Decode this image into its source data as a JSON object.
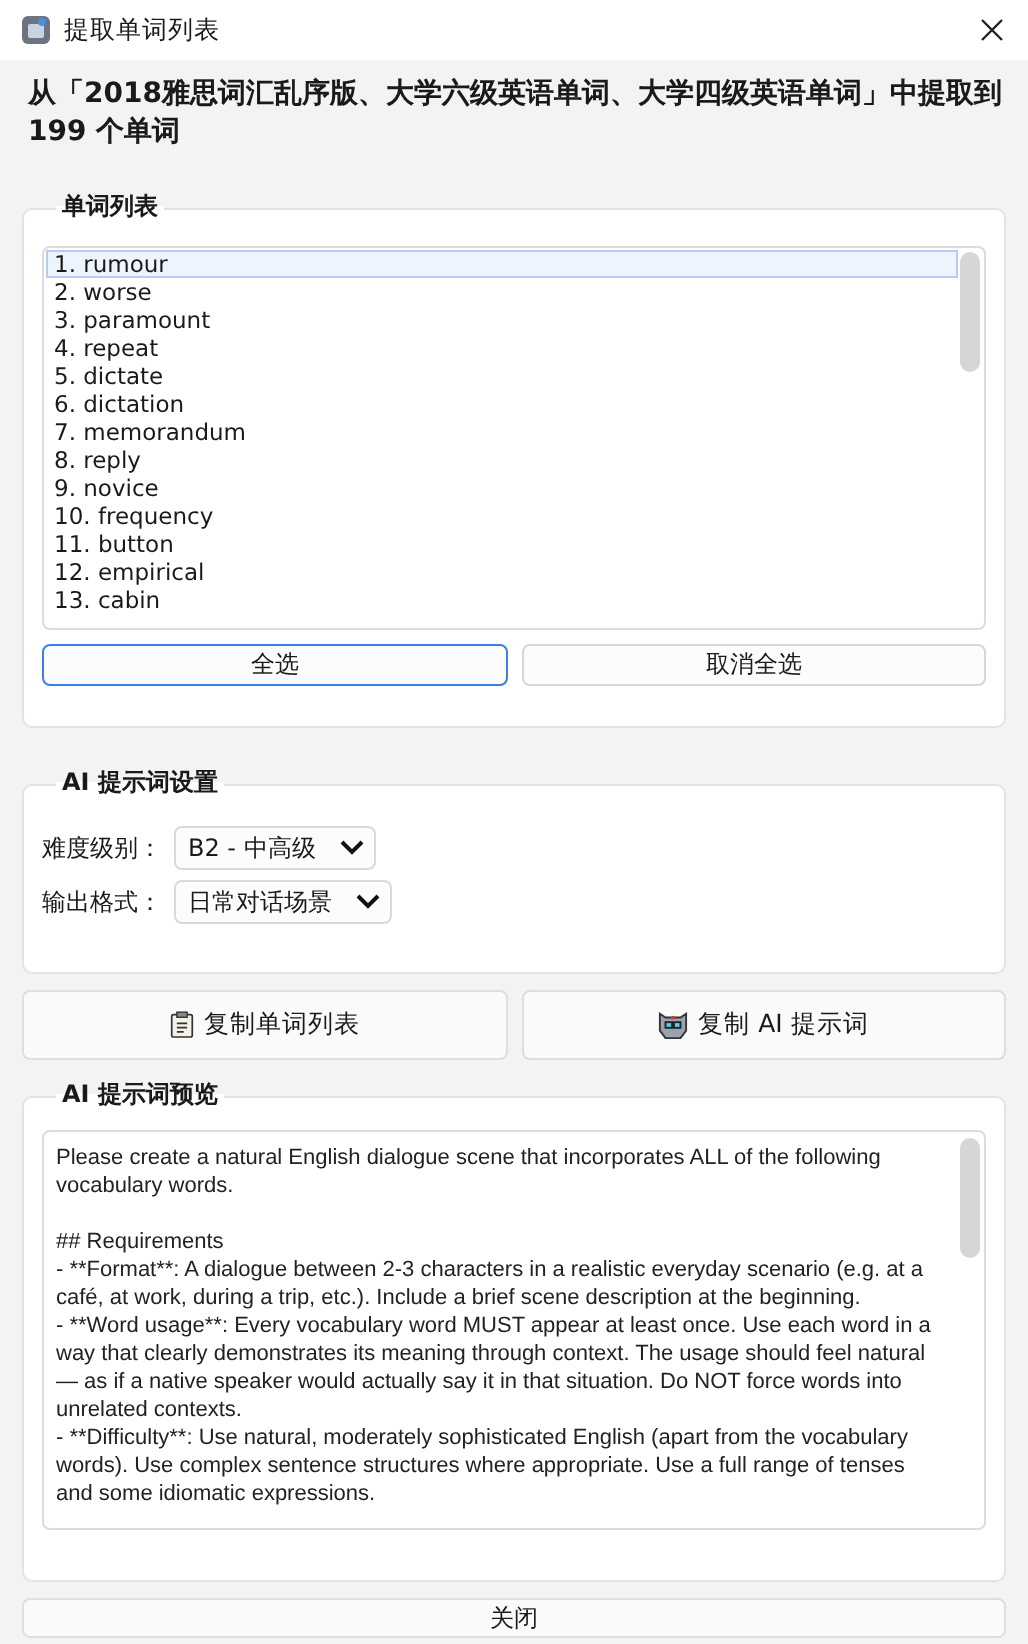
{
  "window": {
    "title": "提取单词列表"
  },
  "heading": "从「2018雅思词汇乱序版、大学六级英语单词、大学四级英语单词」中提取到 199 个单词",
  "word_group": {
    "title": "单词列表",
    "items": [
      {
        "label": "1. rumour",
        "selected": true
      },
      {
        "label": "2. worse",
        "selected": false
      },
      {
        "label": "3. paramount",
        "selected": false
      },
      {
        "label": "4. repeat",
        "selected": false
      },
      {
        "label": "5. dictate",
        "selected": false
      },
      {
        "label": "6. dictation",
        "selected": false
      },
      {
        "label": "7. memorandum",
        "selected": false
      },
      {
        "label": "8. reply",
        "selected": false
      },
      {
        "label": "9. novice",
        "selected": false
      },
      {
        "label": "10. frequency",
        "selected": false
      },
      {
        "label": "11. button",
        "selected": false
      },
      {
        "label": "12. empirical",
        "selected": false
      },
      {
        "label": "13. cabin",
        "selected": false
      }
    ],
    "buttons": [
      {
        "label": "全选",
        "focused": true
      },
      {
        "label": "取消全选",
        "focused": false
      }
    ]
  },
  "settings_group": {
    "title": "AI 提示词设置",
    "fields": [
      {
        "label": "难度级别：",
        "value": "B2 - 中高级"
      },
      {
        "label": "输出格式：",
        "value": "日常对话场景"
      }
    ]
  },
  "actions": [
    {
      "label": "复制单词列表",
      "kind": "clipboard"
    },
    {
      "label": "复制 AI 提示词",
      "kind": "robot"
    }
  ],
  "preview_group": {
    "title": "AI 提示词预览",
    "text": "Please create a natural English dialogue scene that incorporates ALL of the following vocabulary words.\n\n## Requirements\n- **Format**: A dialogue between 2-3 characters in a realistic everyday scenario (e.g. at a café, at work, during a trip, etc.). Include a brief scene description at the beginning.\n- **Word usage**: Every vocabulary word MUST appear at least once. Use each word in a way that clearly demonstrates its meaning through context. The usage should feel natural — as if a native speaker would actually say it in that situation. Do NOT force words into unrelated contexts.\n- **Difficulty**: Use natural, moderately sophisticated English (apart from the vocabulary words). Use complex sentence structures where appropriate. Use a full range of tenses and some idiomatic expressions."
  },
  "close_button": "关闭"
}
